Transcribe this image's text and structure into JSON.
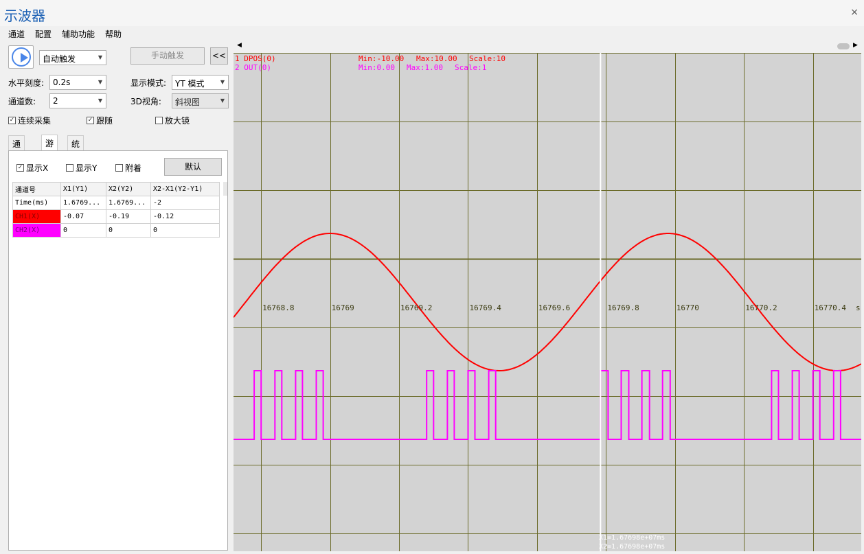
{
  "window": {
    "title": "示波器",
    "close_glyph": "×"
  },
  "menu": [
    "通道",
    "配置",
    "辅助功能",
    "帮助"
  ],
  "controls": {
    "trigger_mode": "自动触发",
    "manual_trigger": "手动触发",
    "collapse": "<<",
    "hscale_label": "水平刻度:",
    "hscale_value": "0.2s",
    "display_mode_label": "显示模式:",
    "display_mode_value": "YT 模式",
    "channels_label": "通道数:",
    "channels_value": "2",
    "view3d_label": "3D视角:",
    "view3d_value": "斜视图",
    "continuous": "连续采集",
    "follow": "跟随",
    "magnifier": "放大镜"
  },
  "checks": {
    "continuous": true,
    "follow": true,
    "magnifier": false,
    "show_x": true,
    "show_y": false,
    "attach": false
  },
  "tabs": [
    "通道号",
    "游标",
    "统计"
  ],
  "cursor": {
    "show_x": "显示X",
    "show_y": "显示Y",
    "attach": "附着",
    "default_btn": "默认",
    "headers": [
      "通道号",
      "X1(Y1)",
      "X2(Y2)",
      "X2-X1(Y2-Y1)"
    ],
    "rows": [
      {
        "name": "Time(ms)",
        "x1": "1.6769...",
        "x2": "1.6769...",
        "d": "-2",
        "color": ""
      },
      {
        "name": "CH1(X)",
        "x1": "-0.07",
        "x2": "-0.19",
        "d": "-0.12",
        "color": "#ff0000"
      },
      {
        "name": "CH2(X)",
        "x1": "0",
        "x2": "0",
        "d": "0",
        "color": "#ff00ff"
      }
    ]
  },
  "colors": {
    "ch1": "#ff0000",
    "ch2": "#ff00ff",
    "grid": "#6b6b2a",
    "plot_bg": "#d3d3d3"
  },
  "scope": {
    "legend": [
      {
        "label": "1 DPOS(0)",
        "min": "Min:-10.00",
        "max": "Max:10.00",
        "scale": "Scale:10"
      },
      {
        "label": "2 OUT(0)",
        "min": "Min:0.00",
        "max": "Max:1.00",
        "scale": "Scale:1"
      }
    ],
    "time_ticks": [
      "16768.8",
      "16769",
      "16769.2",
      "16769.4",
      "16769.6",
      "16769.8",
      "16770",
      "16770.2",
      "16770.4"
    ],
    "time_unit": "s",
    "cursor_x1": "X1=1.67698e+07ms",
    "cursor_x2": "X2=1.67698e+07ms"
  },
  "chart_data": {
    "type": "line",
    "xlabel": "s",
    "x_ticks": [
      16768.8,
      16769.0,
      16769.2,
      16769.4,
      16769.6,
      16769.8,
      16770.0,
      16770.2,
      16770.4
    ],
    "xlim": [
      16768.72,
      16770.54
    ],
    "cursor_x": 16769.784,
    "series": [
      {
        "name": "1 DPOS(0)",
        "kind": "sine",
        "period_s": 0.98,
        "peak_at_s": 16769.0,
        "amplitude": 10,
        "ylim": [
          -10,
          10
        ]
      },
      {
        "name": "2 OUT(0)",
        "kind": "pulse",
        "ylim": [
          0,
          1
        ],
        "pulses_s": [
          [
            16768.78,
            16768.8
          ],
          [
            16768.84,
            16768.86
          ],
          [
            16768.9,
            16768.92
          ],
          [
            16768.96,
            16768.98
          ],
          [
            16769.28,
            16769.3
          ],
          [
            16769.34,
            16769.36
          ],
          [
            16769.4,
            16769.42
          ],
          [
            16769.46,
            16769.48
          ],
          [
            16769.784,
            16769.806
          ],
          [
            16769.844,
            16769.866
          ],
          [
            16769.904,
            16769.926
          ],
          [
            16769.964,
            16769.986
          ],
          [
            16770.28,
            16770.3
          ],
          [
            16770.34,
            16770.36
          ],
          [
            16770.4,
            16770.42
          ],
          [
            16770.46,
            16770.48
          ]
        ]
      }
    ]
  }
}
